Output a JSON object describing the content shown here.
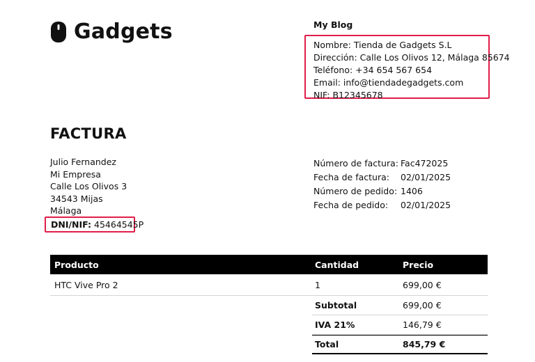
{
  "brand": {
    "name": "Gadgets",
    "icon": "mouse-icon"
  },
  "shop": {
    "blog_title": "My Blog",
    "lines": [
      "Nombre: Tienda de Gadgets S.L",
      "Dirección: Calle Los Olivos 12, Málaga 85674",
      "Teléfono: +34 654 567 654",
      "Email: info@tiendadegadgets.com",
      "NIF: B12345678"
    ]
  },
  "document": {
    "title": "FACTURA"
  },
  "customer": {
    "lines": [
      "Julio Fernandez",
      "Mi Empresa",
      "Calle Los Olivos 3",
      "34543 Mijas",
      "Málaga"
    ],
    "dni_label": "DNI/NIF:",
    "dni_value": "45464545P"
  },
  "invoice_meta": [
    {
      "label": "Número de factura:",
      "value": "Fac472025"
    },
    {
      "label": "Fecha de factura:",
      "value": "02/01/2025"
    },
    {
      "label": "Número de pedido:",
      "value": "1406"
    },
    {
      "label": "Fecha de pedido:",
      "value": "02/01/2025"
    }
  ],
  "table": {
    "headers": {
      "product": "Producto",
      "quantity": "Cantidad",
      "price": "Precio"
    },
    "rows": [
      {
        "product": "HTC Vive Pro 2",
        "quantity": "1",
        "price": "699,00 €"
      }
    ],
    "totals": [
      {
        "label": "Subtotal",
        "value": "699,00 €"
      },
      {
        "label": "IVA 21%",
        "value": "146,79 €"
      },
      {
        "label": "Total",
        "value": "845,79 €"
      }
    ]
  },
  "colors": {
    "highlight": "#e11d48",
    "header_bg": "#000000"
  }
}
